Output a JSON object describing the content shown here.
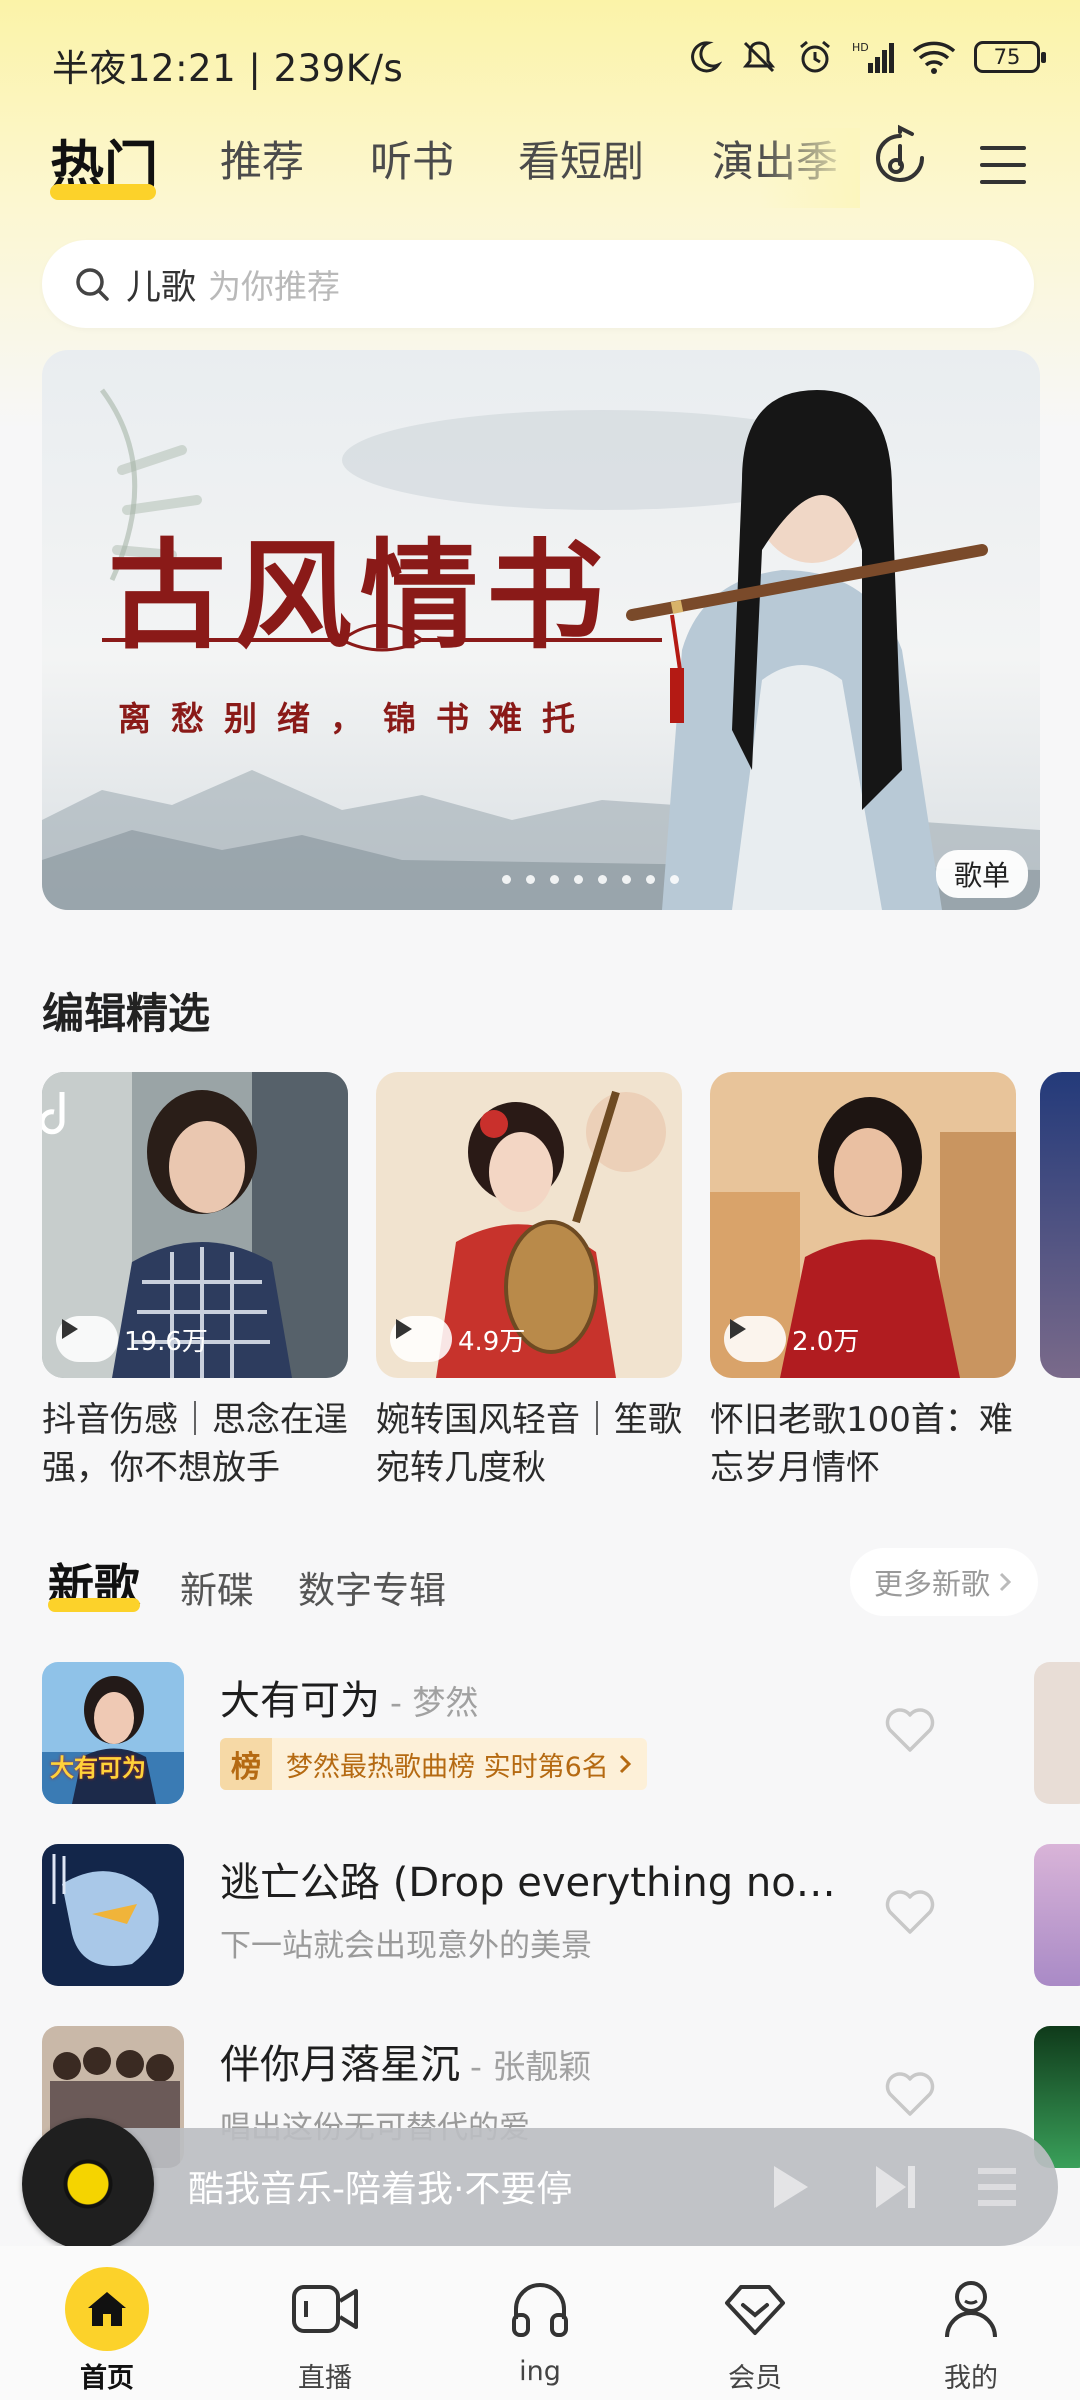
{
  "status_bar": {
    "time_speed": "半夜12:21 | 239K/s",
    "battery": "75"
  },
  "top_tabs": [
    "热门",
    "推荐",
    "听书",
    "看短剧",
    "演出季"
  ],
  "search": {
    "keyword": "儿歌",
    "hint": "为你推荐"
  },
  "banner": {
    "title": "古风情书",
    "subtitle": "离愁别绪，锦书难托",
    "tag": "歌单"
  },
  "editor_picks": {
    "title": "编辑精选",
    "cards": [
      {
        "play_count": "19.6万",
        "title": "抖音伤感｜思念在逞强，你不想放手"
      },
      {
        "play_count": "4.9万",
        "title": "婉转国风轻音｜笙歌宛转几度秋"
      },
      {
        "play_count": "2.0万",
        "title": "怀旧老歌100首：难忘岁月情怀"
      }
    ]
  },
  "new_songs": {
    "tabs": [
      "新歌",
      "新碟",
      "数字专辑"
    ],
    "more": "更多新歌",
    "cover_text_1": "大有可为",
    "songs": [
      {
        "title": "大有可为",
        "artist": "- 梦然",
        "rank_mark": "榜",
        "rank_text": "梦然最热歌曲榜 实时第6名"
      },
      {
        "title": "逃亡公路 (Drop everything no…",
        "subtitle": "下一站就会出现意外的美景"
      },
      {
        "title": "伴你月落星沉",
        "artist": "- 张靓颖",
        "subtitle": "唱出这份无可替代的爱"
      }
    ]
  },
  "player": {
    "text": "酷我音乐-陪着我·不要停"
  },
  "bottom_nav": [
    "首页",
    "直播",
    "ing",
    "会员",
    "我的"
  ],
  "colors": {
    "accent": "#fcd22a",
    "banner_title": "#8a1a18"
  }
}
